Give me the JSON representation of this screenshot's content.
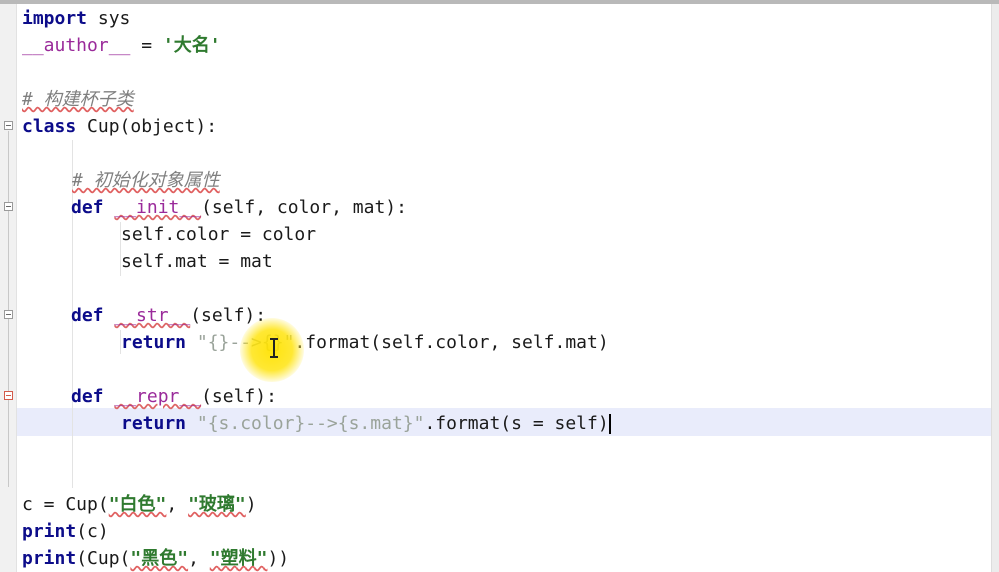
{
  "editor": {
    "lines": {
      "l1": {
        "kw": "import",
        "rest": " sys"
      },
      "l2": {
        "name": "__author__",
        "op": " = ",
        "str": "'大名'"
      },
      "l4": {
        "comment": "# 构建杯子类"
      },
      "l5": {
        "kw": "class",
        "rest": " Cup(object):"
      },
      "l7": {
        "comment": "# 初始化对象属性"
      },
      "l8": {
        "kw": "def",
        "name": "__init__",
        "rest": "(self, color, mat):"
      },
      "l9": {
        "text": "self.color = color"
      },
      "l10": {
        "text": "self.mat = mat"
      },
      "l12": {
        "kw": "def",
        "name": "__str__",
        "rest": "(self):"
      },
      "l13": {
        "kw": "return",
        "str": "\"{}-->{}\"",
        "rest": ".format(self.color, self.mat)"
      },
      "l15": {
        "kw": "def",
        "name": "__repr__",
        "rest": "(self):"
      },
      "l16": {
        "kw": "return",
        "str": "\"{s.color}-->{s.mat}\"",
        "rest": ".format(s = self)"
      },
      "l19": {
        "pre": "c = Cup(",
        "s1": "\"白色\"",
        "sep": ", ",
        "s2": "\"玻璃\"",
        "post": ")"
      },
      "l20": {
        "kw": "print",
        "rest": "(c)"
      },
      "l21": {
        "kw": "print",
        "pre": "(Cup(",
        "s1": "\"黑色\"",
        "sep": ", ",
        "s2": "\"塑料\"",
        "post": "))"
      }
    }
  }
}
